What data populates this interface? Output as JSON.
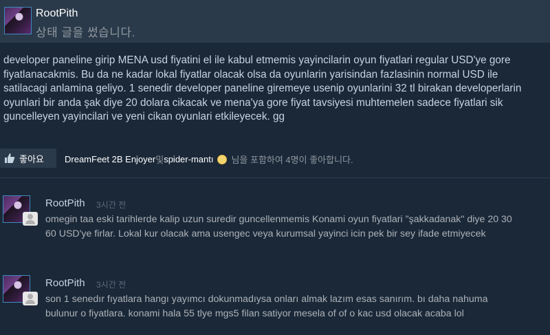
{
  "post": {
    "author": "RootPith",
    "action": "상태 글을 썼습니다.",
    "body": "developer paneline girip MENA usd fiyatini el ile kabul etmemis yayincilarin oyun fiyatlari regular USD'ye gore fiyatlanacakmis. Bu da ne kadar lokal fiyatlar olacak olsa da oyunlarin yarisindan fazlasinin normal USD ile satilacagi anlamina geliyo. 1 senedir developer paneline giremeye usenip oyunlarini 32 tl birakan developerlarin oyunlari bir anda şak diye 20 dolara cikacak ve mena'ya gore fiyat tavsiyesi muhtemelen sadece fiyatlari sik guncelleyen yayincilari ve yeni cikan oyunlari etkileyecek. gg"
  },
  "likes": {
    "button_label": "좋아요",
    "liker1": "DreamFeet 2B Enjoyer",
    "separator": "및",
    "liker2": "spider-mantı",
    "summary": "님을 포함하여 4명이 좋아합니다."
  },
  "comments": [
    {
      "author": "RootPith",
      "time": "3시간 전",
      "text": "omegin taa eski tarihlerde kalip uzun suredir guncellenmemis Konami oyun fiyatlari \"şakkadanak\" diye 20 30 60 USD'ye firlar. Lokal kur olacak ama usengec veya kurumsal yayinci icin pek bir sey ifade etmiyecek"
    },
    {
      "author": "RootPith",
      "time": "3시간 전",
      "text": "son 1 senedır fıyatlara hangı yayımcı dokunmadıysa onları almak lazım esas sanırım. bı daha nahuma bulunur o fiyatlara. konami hala 55 tlye mgs5 filan satiyor mesela of of o kac usd olacak acaba lol"
    }
  ],
  "colors": {
    "background": "#1b2838",
    "header": "#2b3a4a",
    "text": "#c6d4df",
    "muted": "#8f98a0"
  },
  "icons": {
    "like": "thumbs-up-icon",
    "emoticon": "emoticon-icon",
    "user": "user-icon"
  }
}
